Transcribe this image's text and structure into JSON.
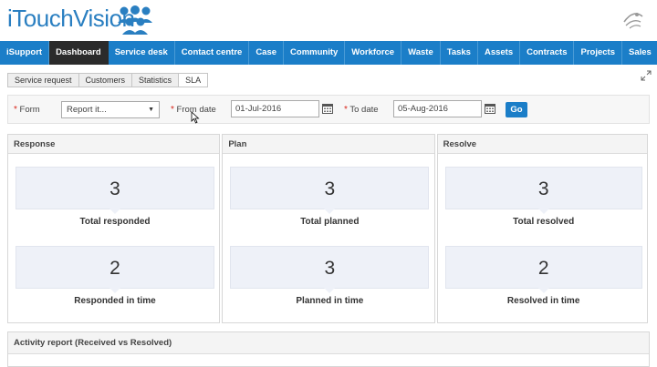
{
  "brand": {
    "logo_text": "iTouchVision",
    "primary": "#1b7ec8",
    "active_nav": "#2b2b2b"
  },
  "nav": [
    {
      "label": "iSupport",
      "active": false
    },
    {
      "label": "Dashboard",
      "active": true
    },
    {
      "label": "Service desk",
      "active": false
    },
    {
      "label": "Contact centre",
      "active": false
    },
    {
      "label": "Case",
      "active": false
    },
    {
      "label": "Community",
      "active": false
    },
    {
      "label": "Workforce",
      "active": false
    },
    {
      "label": "Waste",
      "active": false
    },
    {
      "label": "Tasks",
      "active": false
    },
    {
      "label": "Assets",
      "active": false
    },
    {
      "label": "Contracts",
      "active": false
    },
    {
      "label": "Projects",
      "active": false
    },
    {
      "label": "Sales",
      "active": false
    }
  ],
  "subtabs": [
    {
      "label": "Service request",
      "active": false
    },
    {
      "label": "Customers",
      "active": false
    },
    {
      "label": "Statistics",
      "active": false
    },
    {
      "label": "SLA",
      "active": true
    }
  ],
  "filters": {
    "required_mark": "*",
    "form_label": "Form",
    "form_value": "Report it...",
    "from_label": "From date",
    "from_value": "01-Jul-2016",
    "to_label": "To date",
    "to_value": "05-Aug-2016",
    "go_label": "Go"
  },
  "panels": [
    {
      "title": "Response",
      "metrics": [
        {
          "value": "3",
          "label": "Total responded"
        },
        {
          "value": "2",
          "label": "Responded in time"
        }
      ]
    },
    {
      "title": "Plan",
      "metrics": [
        {
          "value": "3",
          "label": "Total planned"
        },
        {
          "value": "3",
          "label": "Planned in time"
        }
      ]
    },
    {
      "title": "Resolve",
      "metrics": [
        {
          "value": "3",
          "label": "Total resolved"
        },
        {
          "value": "2",
          "label": "Resolved in time"
        }
      ]
    }
  ],
  "activity": {
    "title": "Activity report (Received vs Resolved)"
  }
}
